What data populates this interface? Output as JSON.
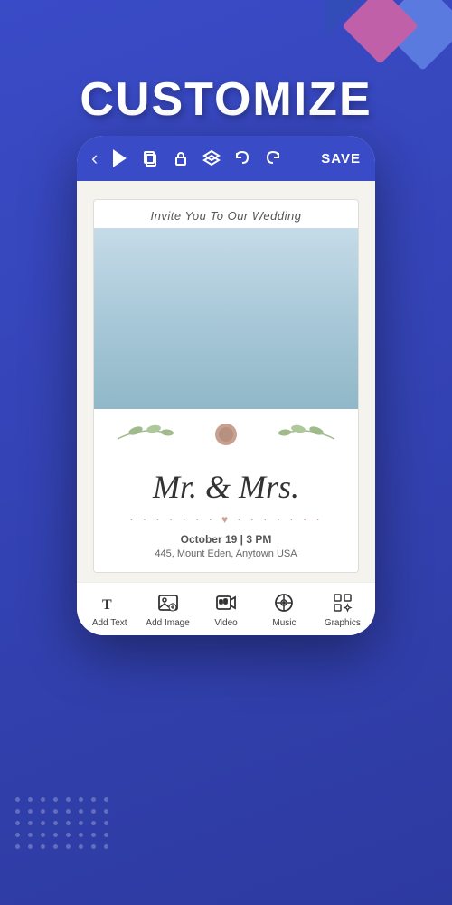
{
  "page": {
    "title": "CUSTOMIZE",
    "background_color": "#3a4bc7"
  },
  "toolbar": {
    "back_label": "‹",
    "play_label": "▶",
    "copy_label": "⧉",
    "lock_label": "🔓",
    "layers_label": "❖",
    "undo_label": "↩",
    "redo_label": "↪",
    "save_label": "SAVE"
  },
  "card": {
    "header_text": "Invite You To Our Wedding",
    "couple_name": "Mr. & Mrs.",
    "date_text": "October 19 | 3 PM",
    "location_text": "445, Mount Eden, Anytown USA"
  },
  "bottom_bar": {
    "items": [
      {
        "id": "add-text",
        "label": "Add Text",
        "icon": "T"
      },
      {
        "id": "add-image",
        "label": "Add Image",
        "icon": "image"
      },
      {
        "id": "video",
        "label": "Video",
        "icon": "video"
      },
      {
        "id": "music",
        "label": "Music",
        "icon": "music"
      },
      {
        "id": "graphics",
        "label": "Graphics",
        "icon": "graphics"
      }
    ]
  }
}
